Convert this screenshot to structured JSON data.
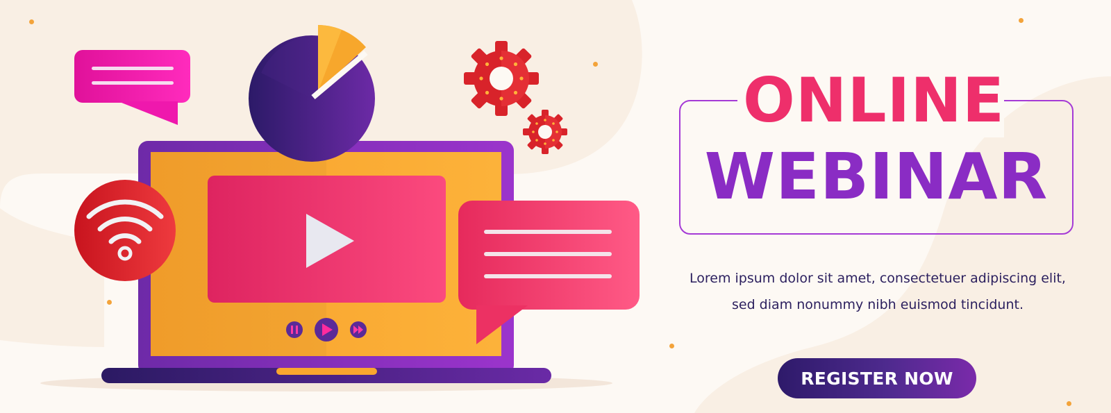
{
  "banner": {
    "title_line1": "ONLINE",
    "title_line2": "WEBINAR",
    "description": "Lorem ipsum dolor sit amet, consectetuer adipiscing elit, sed diam nonummy nibh euismod tincidunt.",
    "cta_label": "REGISTER NOW"
  },
  "illustration": {
    "icons": [
      "laptop-icon",
      "play-icon",
      "pie-chart-icon",
      "gear-icon",
      "wifi-icon",
      "chat-bubble-icon",
      "pause-icon",
      "fast-forward-icon"
    ]
  },
  "colors": {
    "accent_pink": "#ee2f6b",
    "accent_purple": "#8a2cc4",
    "cta_navy": "#2e1a6a",
    "laptop_frame": "#8a2cc4",
    "screen_orange": "#fca52a",
    "gear_red": "#d8232a",
    "bubble_magenta": "#f01ea0",
    "background": "#fdf9f4"
  }
}
